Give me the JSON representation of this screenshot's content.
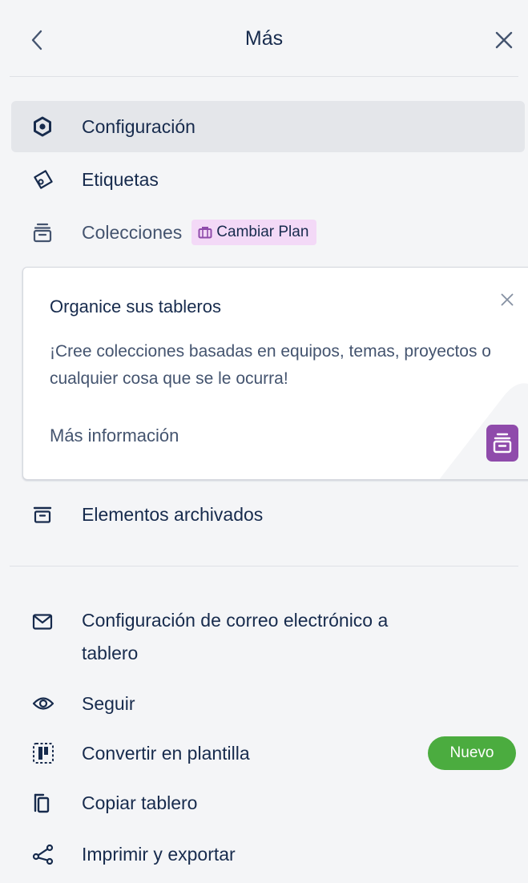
{
  "header": {
    "title": "Más"
  },
  "menu_top": {
    "settings": "Configuración",
    "labels": "Etiquetas",
    "collections": "Colecciones",
    "upgrade_label": "Cambiar Plan"
  },
  "promo": {
    "title": "Organice sus tableros",
    "body": "¡Cree colecciones basadas en equipos, temas, proyectos o cualquier cosa que se le ocurra!",
    "link": "Más información"
  },
  "menu_middle": {
    "archived": "Elementos archivados"
  },
  "menu_bottom": {
    "email_line1": "Configuración de correo electrónico a",
    "email_line2": "tablero",
    "watch": "Seguir",
    "template": "Convertir en plantilla",
    "new_badge": "Nuevo",
    "copy": "Copiar tablero",
    "print": "Imprimir y exportar"
  },
  "colors": {
    "accent_purple": "#8f4bab",
    "pill_bg": "#f3d9f7",
    "new_green": "#4bac3f",
    "active_row": "#e4e6ea"
  }
}
